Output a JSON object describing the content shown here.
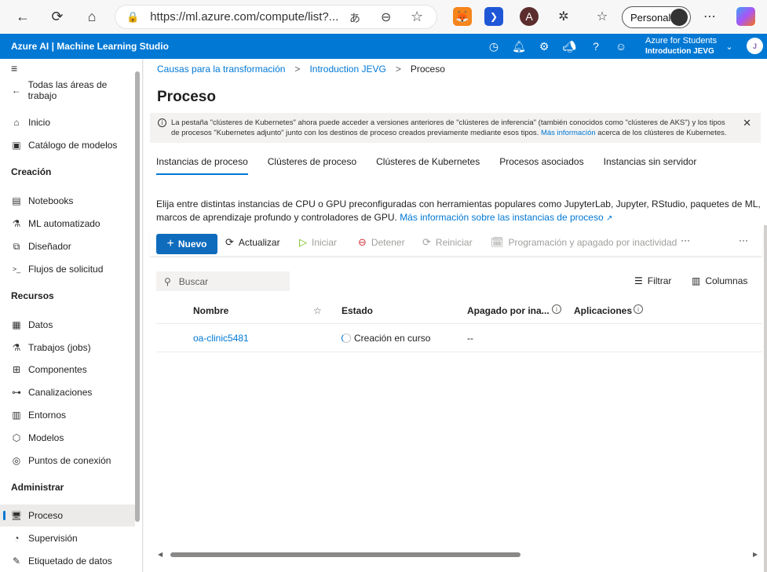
{
  "browser": {
    "url": "https://ml.azure.com/compute/list?...",
    "profile_label": "Personal",
    "back_icon": "←",
    "reload_icon": "⟳",
    "home_icon": "⌂",
    "lock_icon": "🔒",
    "read_aloud_icon": "あ",
    "zoom_icon": "⊖",
    "favorite_icon": "☆",
    "more_icon": "⋯"
  },
  "azure": {
    "title": "Azure AI | Machine Learning Studio",
    "subscription": "Azure for Students",
    "workspace": "Introduction JEVG",
    "avatar_initial": "J"
  },
  "sidebar": {
    "back_label": "Todas las áreas de trabajo",
    "items_top": [
      {
        "label": "Inicio",
        "icon": "⌂"
      },
      {
        "label": "Catálogo de modelos",
        "icon": "▣"
      }
    ],
    "section_creacion": "Creación",
    "items_creacion": [
      {
        "label": "Notebooks",
        "icon": "▤"
      },
      {
        "label": "ML automatizado",
        "icon": "⚗"
      },
      {
        "label": "Diseñador",
        "icon": "⧉"
      },
      {
        "label": "Flujos de solicitud",
        "icon": ">_"
      }
    ],
    "section_recursos": "Recursos",
    "items_recursos": [
      {
        "label": "Datos",
        "icon": "▦"
      },
      {
        "label": "Trabajos (jobs)",
        "icon": "⚗"
      },
      {
        "label": "Componentes",
        "icon": "⊞"
      },
      {
        "label": "Canalizaciones",
        "icon": "⊶"
      },
      {
        "label": "Entornos",
        "icon": "▥"
      },
      {
        "label": "Modelos",
        "icon": "⬡"
      },
      {
        "label": "Puntos de conexión",
        "icon": "◎"
      }
    ],
    "section_administrar": "Administrar",
    "items_administrar": [
      {
        "label": "Proceso",
        "icon": "🖥"
      },
      {
        "label": "Supervisión",
        "icon": "◔"
      },
      {
        "label": "Etiquetado de datos",
        "icon": "✎"
      }
    ]
  },
  "breadcrumb": {
    "item1": "Causas para la transformación",
    "item2": "Introduction JEVG",
    "item3": "Proceso",
    "separator": ">"
  },
  "page": {
    "title": "Proceso",
    "banner_text": "La pestaña \"clústeres de Kubernetes\" ahora puede acceder a versiones anteriores de \"clústeres de inferencia\" (también conocidos como \"clústeres de AKS\") y los tipos de procesos \"Kubernetes adjunto\" junto con los destinos de proceso creados previamente mediante esos tipos.",
    "banner_link": "Más información",
    "banner_suffix": "acerca de los clústeres de Kubernetes.",
    "tabs": [
      "Instancias de proceso",
      "Clústeres de proceso",
      "Clústeres de Kubernetes",
      "Procesos asociados",
      "Instancias sin servidor"
    ],
    "description": "Elija entre distintas instancias de CPU o GPU preconfiguradas con herramientas populares como JupyterLab, Jupyter, RStudio, paquetes de ML, marcos de aprendizaje profundo y controladores de GPU.",
    "description_link": "Más información sobre las instancias de proceso"
  },
  "toolbar": {
    "new": "Nuevo",
    "refresh": "Actualizar",
    "start": "Iniciar",
    "stop": "Detener",
    "restart": "Reiniciar",
    "schedule": "Programación y apagado por inactividad",
    "more": "···"
  },
  "search": {
    "placeholder": "Buscar"
  },
  "filters": {
    "filter": "Filtrar",
    "columns": "Columnas"
  },
  "table": {
    "headers": [
      "Nombre",
      "Estado",
      "Apagado por ina...",
      "Aplicaciones"
    ],
    "rows": [
      {
        "name": "oa-clinic5481",
        "status": "Creación en curso",
        "shutdown": "--",
        "apps": ""
      }
    ]
  }
}
